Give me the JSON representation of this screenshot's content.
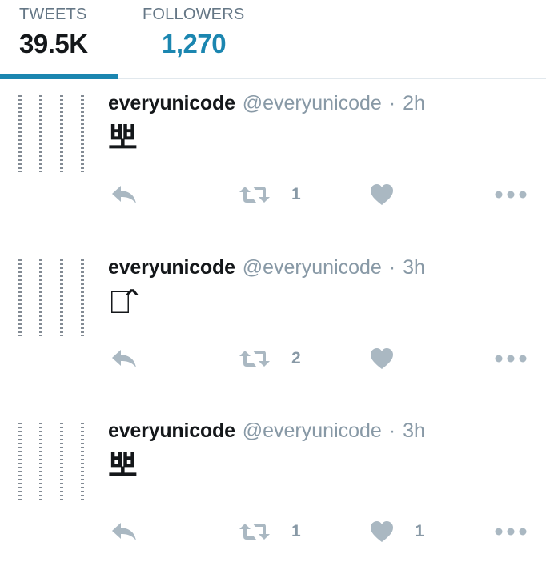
{
  "stats": {
    "tweets": {
      "label": "TWEETS",
      "value": "39.5K"
    },
    "followers": {
      "label": "FOLLOWERS",
      "value": "1,270"
    }
  },
  "tweets": [
    {
      "fullname": "everyunicode",
      "username": "@everyunicode",
      "separator": "·",
      "time": "2h",
      "text": "뽀",
      "retweets": "1",
      "likes": ""
    },
    {
      "fullname": "everyunicode",
      "username": "@everyunicode",
      "separator": "·",
      "time": "3h",
      "text": "뽀̂",
      "retweets": "2",
      "likes": ""
    },
    {
      "fullname": "everyunicode",
      "username": "@everyunicode",
      "separator": "·",
      "time": "3h",
      "text": "뽀",
      "retweets": "1",
      "likes": "1"
    }
  ],
  "icons": {
    "reply": "reply-icon",
    "retweet": "retweet-icon",
    "like": "heart-icon",
    "more": "more-dots-icon"
  },
  "colors": {
    "accent": "#1b86b0",
    "muted": "#8899a6",
    "icon": "#aab8c2",
    "text": "#14171a"
  }
}
